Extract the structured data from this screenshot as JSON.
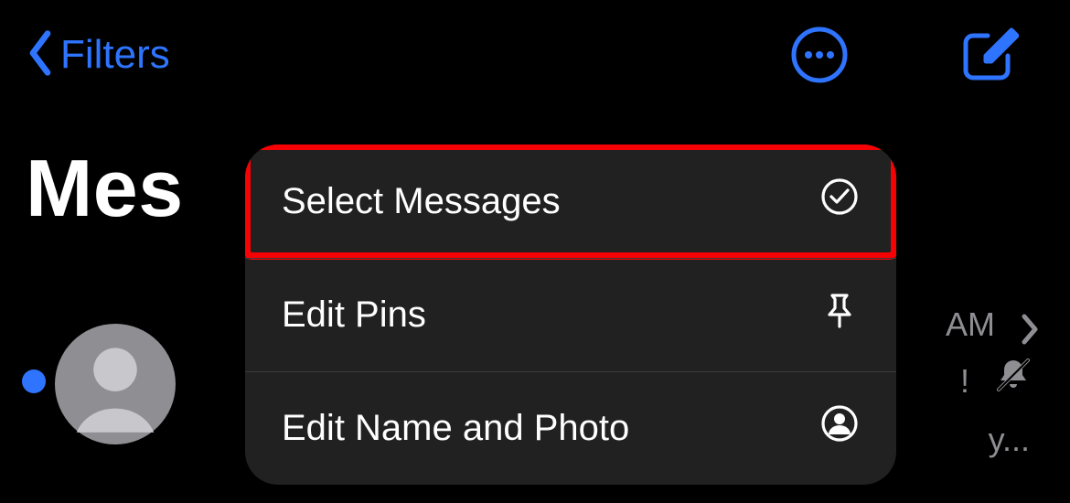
{
  "nav": {
    "back_label": "Filters",
    "icons": {
      "more": "ellipsis-circle-icon",
      "compose": "compose-icon",
      "back": "chevron-left-icon"
    }
  },
  "large_title": "Mes",
  "menu": {
    "items": [
      {
        "label": "Select Messages",
        "icon": "checkmark-circle-icon",
        "highlighted": true
      },
      {
        "label": "Edit Pins",
        "icon": "pin-icon"
      },
      {
        "label": "Edit Name and Photo",
        "icon": "person-circle-icon"
      }
    ]
  },
  "row": {
    "time_fragment": "AM",
    "snippet_fragment_1": "!",
    "snippet_fragment_2": "y...",
    "avatar_icon": "person-silhouette-icon",
    "mute_icon": "bell-slash-icon",
    "chevron_icon": "chevron-right-icon"
  },
  "colors": {
    "accent": "#2f74ff",
    "highlight_ring": "#f60204",
    "menu_bg": "#232323",
    "secondary_text": "#8e8e93"
  }
}
